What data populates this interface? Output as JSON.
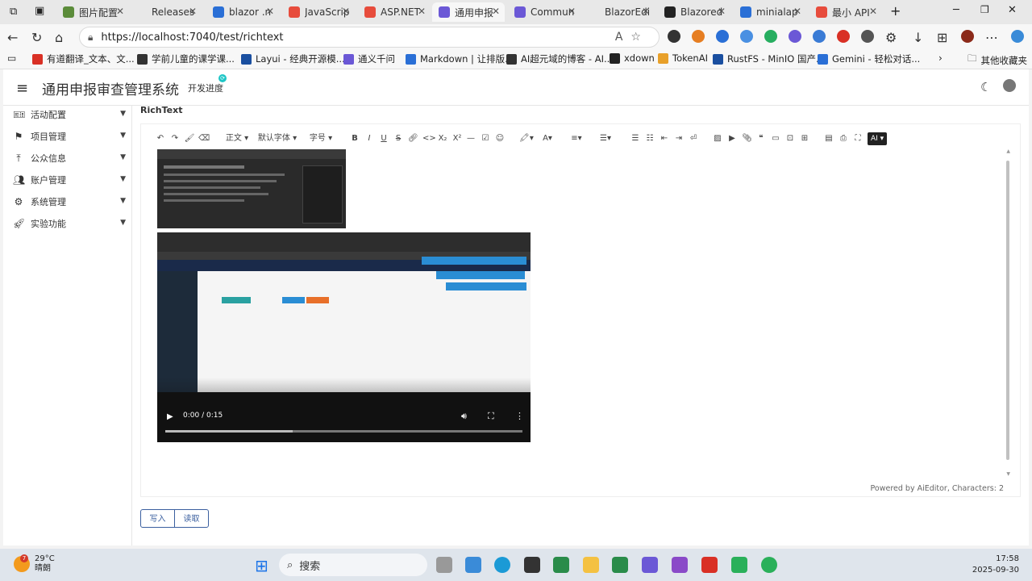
{
  "browser": {
    "tabs": [
      {
        "label": "图片配置",
        "color": "#5b8c3a"
      },
      {
        "label": "Releases",
        "color": "#e8e8e8"
      },
      {
        "label": "blazor .n",
        "color": "#2a6fd6"
      },
      {
        "label": "JavaScrip",
        "color": "#e74c3c"
      },
      {
        "label": "ASP.NET",
        "color": "#e74c3c"
      },
      {
        "label": "通用申报",
        "color": "#6b58d6"
      },
      {
        "label": "Commun",
        "color": "#6b58d6"
      },
      {
        "label": "BlazorEdi",
        "color": "#e8e8e8"
      },
      {
        "label": "Blazored",
        "color": "#222222"
      },
      {
        "label": "minialap",
        "color": "#2a6fd6"
      },
      {
        "label": "最小 API",
        "color": "#e74c3c"
      }
    ],
    "url": "https://localhost:7040/test/richtext",
    "bookmarks": [
      "有道翻译_文本、文...",
      "学前儿童的课学课...",
      "Layui - 经典开源模...",
      "通义千问",
      "Markdown | 让排版...",
      "AI超元域的博客 - AI...",
      "xdown",
      "TokenAI",
      "RustFS - MinIO 国产...",
      "Gemini - 轻松对话..."
    ],
    "other_bookmarks": "其他收藏夹"
  },
  "app": {
    "title": "通用申报审查管理系统",
    "dev_progress": "开发进度",
    "sidebar": [
      {
        "label": "活动配置",
        "icon": "ticket-icon"
      },
      {
        "label": "项目管理",
        "icon": "flag-icon"
      },
      {
        "label": "公众信息",
        "icon": "upload-icon"
      },
      {
        "label": "账户管理",
        "icon": "user-gear-icon"
      },
      {
        "label": "系统管理",
        "icon": "gear-icon"
      },
      {
        "label": "实验功能",
        "icon": "rocket-icon"
      }
    ],
    "page_title": "RichText",
    "toolbar": {
      "paragraph": "正文",
      "font": "默认字体",
      "size": "字号",
      "ai": "AI"
    },
    "video": {
      "time": "0:00 / 0:15"
    },
    "footer": "Powered by AiEditor, Characters: 2",
    "write_button": "写入",
    "read_button": "读取"
  },
  "taskbar": {
    "temp": "29°C",
    "weather": "晴朗",
    "weather_badge": "7",
    "search": "搜索",
    "time": "17:58",
    "date": "2025-09-30"
  }
}
